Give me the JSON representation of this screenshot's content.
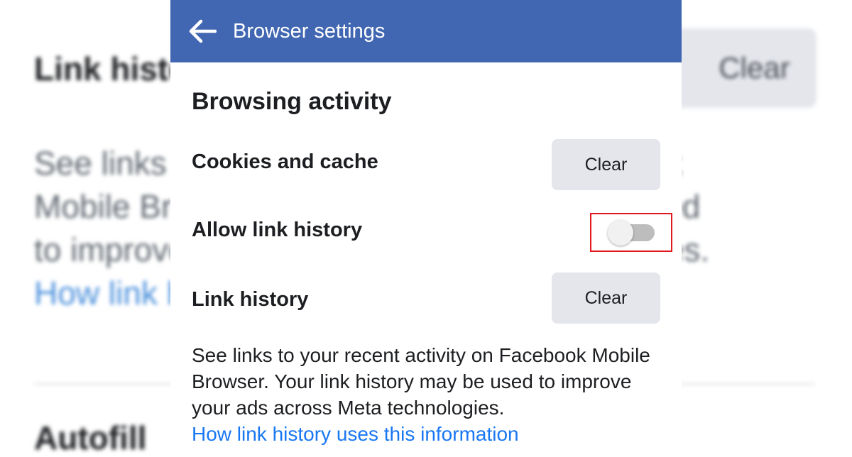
{
  "background": {
    "title": "Link history",
    "clear_label": "Clear",
    "description_lines": [
      "See links to your recent activity on Facebook",
      "Mobile Browser. Your link history may be used",
      "to improve your ads across Meta technologies."
    ],
    "link": "How link history uses this information",
    "autofill_label": "Autofill"
  },
  "header": {
    "title": "Browser settings",
    "back_icon": "arrow-left-icon",
    "color": "#4267b2"
  },
  "section": {
    "title": "Browsing activity"
  },
  "rows": {
    "cookies": {
      "label": "Cookies and cache",
      "button": "Clear"
    },
    "allow_link_history": {
      "label": "Allow link history",
      "enabled": false
    },
    "link_history": {
      "label": "Link history",
      "button": "Clear"
    }
  },
  "description": {
    "text": "See links to your recent activity on Facebook Mobile Browser. Your link history may be used to improve your ads across Meta technologies.",
    "link": "How link history uses this information"
  },
  "colors": {
    "link": "#1877f2",
    "highlight_border": "#e0191f",
    "button_bg": "#e4e6eb"
  }
}
